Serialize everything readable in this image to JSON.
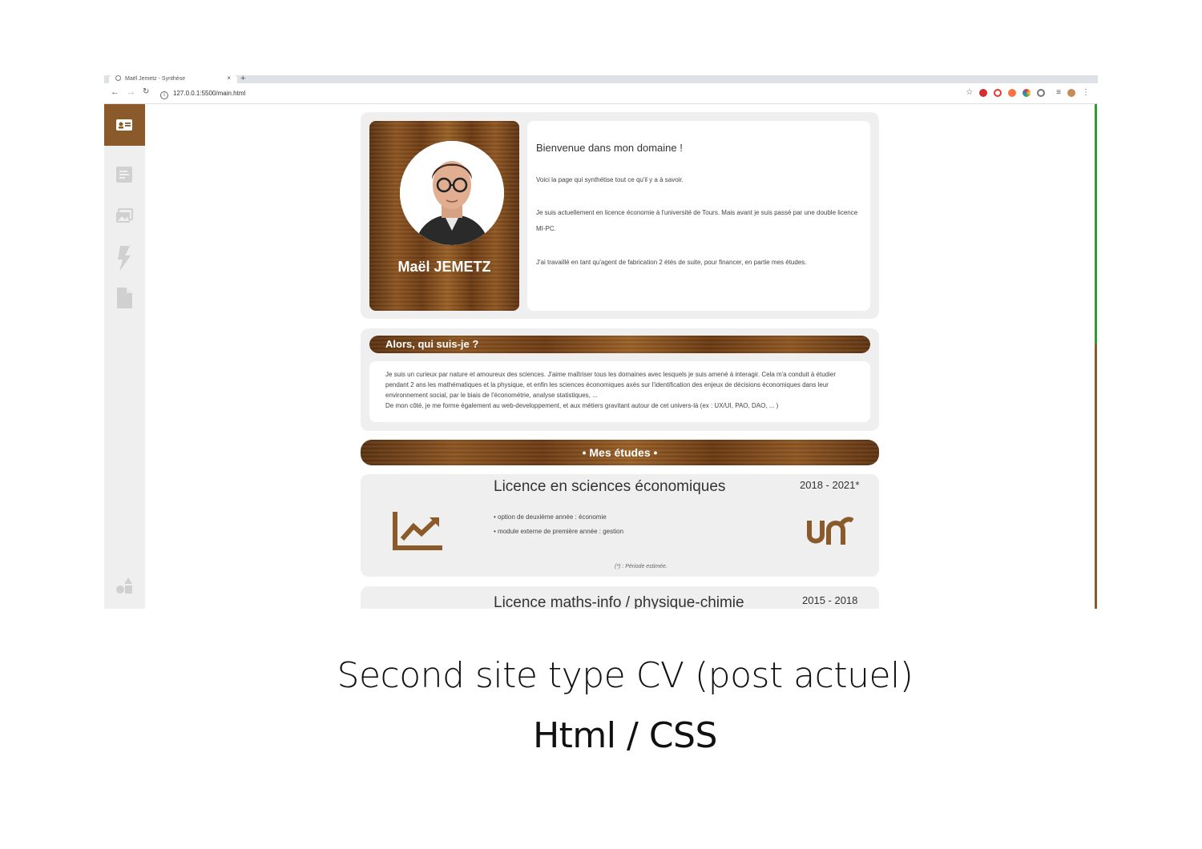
{
  "browser": {
    "tab_title": "Maël Jemetz - Synthèse",
    "url": "127.0.0.1:5500/main.html",
    "extension_icons": [
      "star-icon",
      "red-icon",
      "opera-icon",
      "orange-icon",
      "color-icon",
      "circle-icon"
    ]
  },
  "sidebar": {
    "items": [
      "id-card-icon",
      "list-icon",
      "gallery-icon",
      "lightning-icon",
      "document-icon"
    ],
    "bottom": "shapes-icon",
    "accent": "#8b5a2b"
  },
  "profile": {
    "name": "Maël JEMETZ"
  },
  "welcome": {
    "title": "Bienvenue dans mon domaine !",
    "p1": "Voici la page qui synthétise tout ce qu'il y a à savoir.",
    "p2": "Je suis actuellement en licence économie à l'université de Tours. Mais avant je suis passé par une double licence MI-PC.",
    "p3": "J'ai travaillé en tant qu'agent de fabrication 2 étés de suite, pour financer, en partie mes études."
  },
  "about": {
    "title": "Alors, qui suis-je ?",
    "text1": "Je suis un curieux par nature et amoureux des sciences. J'aime maîtriser tous les domaines avec lesquels je suis amené à interagir. Cela m'a conduit à étudier pendant 2 ans les mathématiques et la physique, et enfin les sciences économiques axés sur l'identification des enjeux de décisions économiques dans leur environnement social, par le biais de l'économétrie, analyse statistiques, ...",
    "text2": "De mon côté, je me forme également au web-developpement, et aux métiers gravitant autour de cet univers-là (ex : UX/UI, PAO, DAO, ... )"
  },
  "studies": {
    "banner": "• Mes études •",
    "items": [
      {
        "title": "Licence en sciences économiques",
        "date": "2018 - 2021*",
        "bullets": [
          "• option de deuxième année : économie",
          "• module externe de première année : gestion"
        ],
        "note": "(*) : Période estimée."
      },
      {
        "title": "Licence maths-info / physique-chimie",
        "date": "2015 - 2018"
      }
    ]
  },
  "caption": {
    "line1": "Second site type CV (post actuel)",
    "line2": "Html / CSS"
  }
}
